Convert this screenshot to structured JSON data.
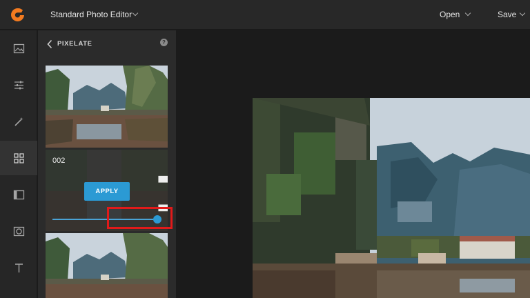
{
  "header": {
    "app_title": "Standard Photo Editor",
    "open_label": "Open",
    "save_label": "Save"
  },
  "rail": {
    "items": [
      {
        "icon": "image-icon"
      },
      {
        "icon": "sliders-icon"
      },
      {
        "icon": "magic-wand-icon"
      },
      {
        "icon": "grid-icon",
        "active": true
      },
      {
        "icon": "frame-icon"
      },
      {
        "icon": "vignette-icon"
      },
      {
        "icon": "text-icon"
      }
    ]
  },
  "panel": {
    "title": "PIXELATE",
    "help": "?",
    "card": {
      "label": "002",
      "apply_label": "APPLY",
      "slider_value": 1.0
    }
  },
  "colors": {
    "accent": "#2b9ad4",
    "highlight": "#e11a1a"
  }
}
